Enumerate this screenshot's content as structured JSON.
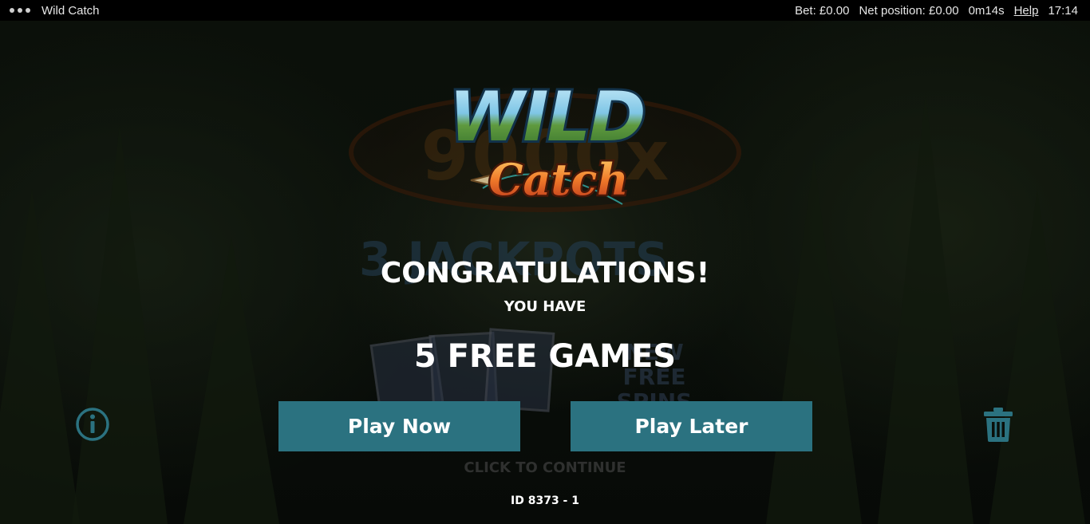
{
  "window": {
    "title": "Wild Catch",
    "menu_icon": "three-dots-menu-icon"
  },
  "status_bar": {
    "bet": "Bet: £0.00",
    "net_position": "Net position: £0.00",
    "session_time": "0m14s",
    "help": "Help",
    "clock": "17:14"
  },
  "logo": {
    "line1": "WILD",
    "line2": "Catch"
  },
  "background_promo": {
    "multiplier": "9000x",
    "jackpots": "3 JACKPOTS",
    "new_feature": "NEW FREE SPINS FEATURES"
  },
  "dialog": {
    "headline": "CONGRATULATIONS!",
    "subline": "YOU HAVE",
    "award": "5 FREE GAMES",
    "play_now": "Play Now",
    "play_later": "Play Later",
    "continue_hint": "CLICK TO CONTINUE",
    "round_id": "ID 8373 - 1"
  },
  "icons": {
    "info": "info-icon",
    "discard": "trash-icon"
  },
  "colors": {
    "button": "#2b7280",
    "icon_accent": "#2b7280",
    "background": "#0a0f0a"
  }
}
